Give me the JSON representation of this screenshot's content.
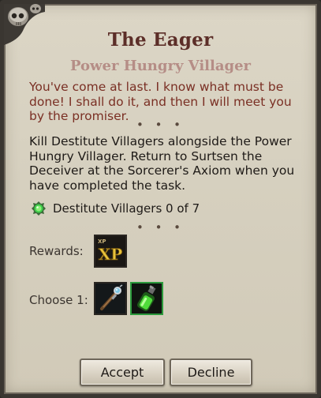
{
  "quest": {
    "title": "The Eager",
    "giver": "Power Hungry Villager",
    "dialog": "You've come at last. I know what must be done! I shall do it, and then I will meet you by the promiser.",
    "separator": "• • •",
    "description": "Kill Destitute Villagers alongside the Power Hungry Villager. Return to Surtsen the Deceiver at the Sorcerer's Axiom when you have completed the task.",
    "objective": {
      "text": "Destitute Villagers 0 of 7",
      "icon": "green-gem-icon"
    }
  },
  "rewards": {
    "label": "Rewards:",
    "items": [
      {
        "icon": "xp-icon",
        "badge_text": "XP",
        "corner_text": "XP"
      }
    ]
  },
  "choose": {
    "label": "Choose 1:",
    "items": [
      {
        "icon": "wand-icon"
      },
      {
        "icon": "green-potion-icon"
      }
    ]
  },
  "buttons": {
    "accept": "Accept",
    "decline": "Decline"
  },
  "colors": {
    "title": "#5c2e28",
    "subtitle": "#b58d86",
    "dialog": "#7a2f24",
    "body_text": "#1e1a17",
    "parchment": "#d6d0bf",
    "potion_border": "#2c9a3c"
  }
}
